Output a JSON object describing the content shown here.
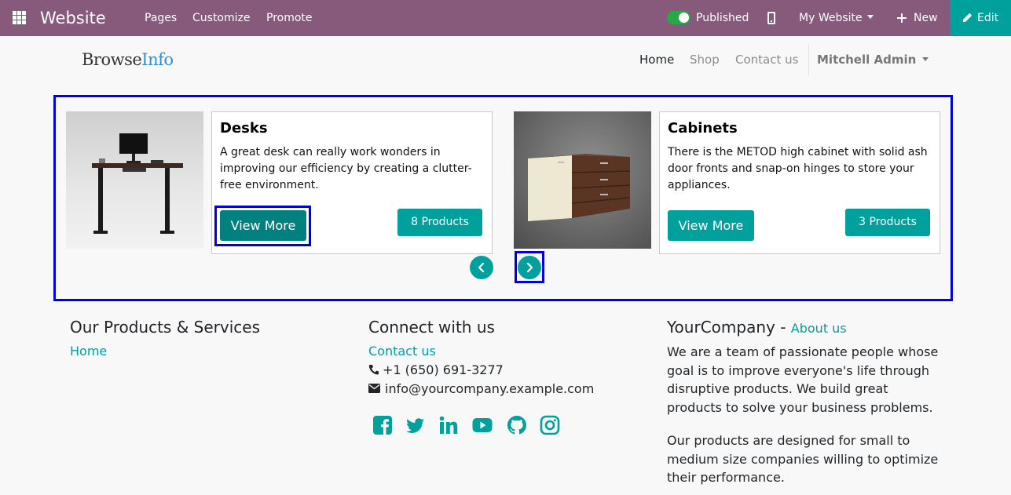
{
  "editor_bar": {
    "app_name": "Website",
    "menus": [
      "Pages",
      "Customize",
      "Promote"
    ],
    "published_label": "Published",
    "website_selector": "My Website",
    "new_label": "New",
    "edit_label": "Edit",
    "bar_color": "#875a7b",
    "edit_color": "#00a09d",
    "published": true
  },
  "site_header": {
    "logo_part1": "Browse",
    "logo_part2": "Info",
    "nav": [
      "Home",
      "Shop",
      "Contact us"
    ],
    "user_menu": "Mitchell Admin"
  },
  "carousel": {
    "cards": [
      {
        "title": "Desks",
        "description": "A great desk can really work wonders in improving our efficiency by creating a clutter-free environment.",
        "view_label": "View More",
        "count_label": "8 Products",
        "image": "standing-desk-image"
      },
      {
        "title": "Cabinets",
        "description": "There is the METOD high cabinet with solid ash door fronts and snap-on hinges to store your appliances.",
        "view_label": "View More",
        "count_label": "3 Products",
        "image": "wall-cabinet-image"
      }
    ],
    "prev_icon": "chevron-left-icon",
    "next_icon": "chevron-right-icon",
    "accent": "#00a09d",
    "highlight_color": "#0000e0"
  },
  "footer": {
    "col1": {
      "title": "Our Products & Services",
      "link": "Home"
    },
    "col2": {
      "title": "Connect with us",
      "link": "Contact us",
      "phone": "+1 (650) 691-3277",
      "email": "info@yourcompany.example.com",
      "social_icons": [
        "facebook-icon",
        "twitter-icon",
        "linkedin-icon",
        "youtube-icon",
        "github-icon",
        "instagram-icon"
      ]
    },
    "col3": {
      "company": "YourCompany",
      "separator": " - ",
      "about_link": "About us",
      "para1": "We are a team of passionate people whose goal is to improve everyone's life through disruptive products. We build great products to solve your business problems.",
      "para2": "Our products are designed for small to medium size companies willing to optimize their performance."
    }
  }
}
